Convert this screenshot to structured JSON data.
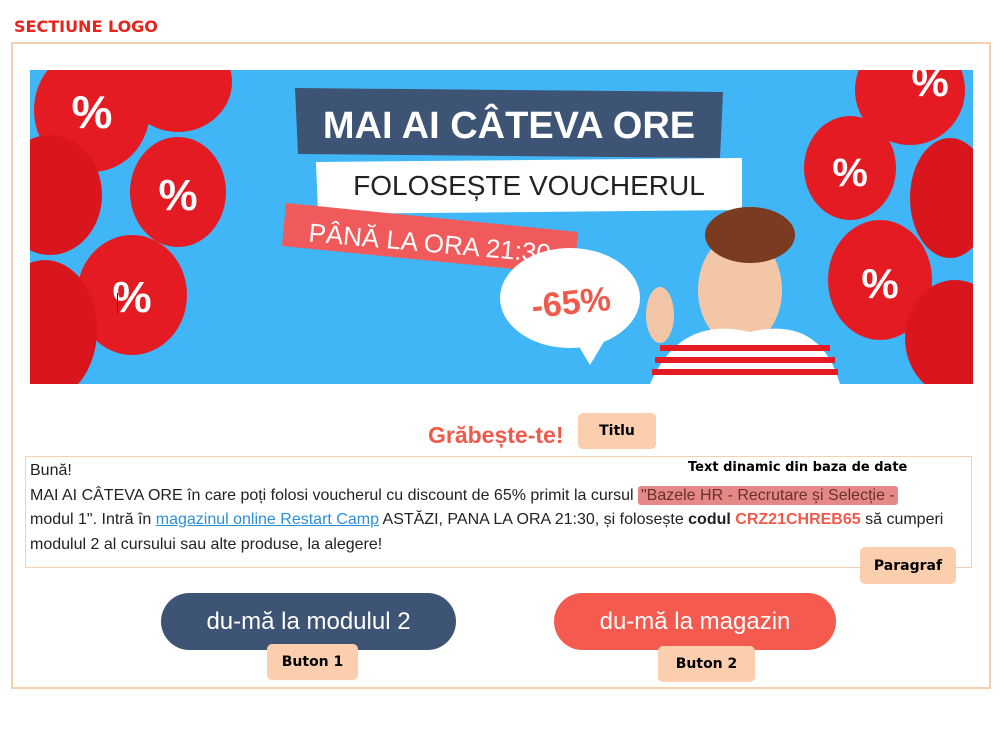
{
  "section_label": "SECTIUNE LOGO",
  "banner": {
    "headline": "MAI AI CÂTEVA ORE",
    "subline": "FOLOSEȘTE VOUCHERUL",
    "deadline": "PÂNĂ LA ORA 21:30",
    "discount": "-65%",
    "balloon_symbol": "%",
    "colors": {
      "background": "#40b6f6",
      "balloon": "#e51b23",
      "headline_bg": "#3d5475",
      "deadline_bg": "#f05a5a"
    }
  },
  "title": "Grăbește-te!",
  "annotations": {
    "title_tag": "Titlu",
    "dynamic_text": "Text dinamic din baza de date",
    "paragraph_tag": "Paragraf",
    "button1_tag": "Buton 1",
    "button2_tag": "Buton 2"
  },
  "paragraph": {
    "greeting": "Bună!",
    "part1": "MAI AI CÂTEVA ORE în care poți folosi voucherul cu discount de 65% primit la cursul ",
    "course_name": "\"Bazele HR - Recrutare și Selecție - ",
    "part2": "modul 1\". Intră în ",
    "link_text": "magazinul online Restart Camp",
    "part3": " ASTĂZI, PANA LA ORA 21:30, și folosește ",
    "code_label": "codul",
    "code": "CRZ21CHREB65",
    "part4": " să cumperi modulul 2 al cursului sau alte produse, la alegere!"
  },
  "buttons": {
    "module": "du-mă la modulul 2",
    "shop": "du-mă la magazin"
  },
  "colors": {
    "accent": "#f05a4b",
    "navy": "#3d5475",
    "tag_bg": "#fbcfae",
    "frame": "#f6cfae"
  }
}
